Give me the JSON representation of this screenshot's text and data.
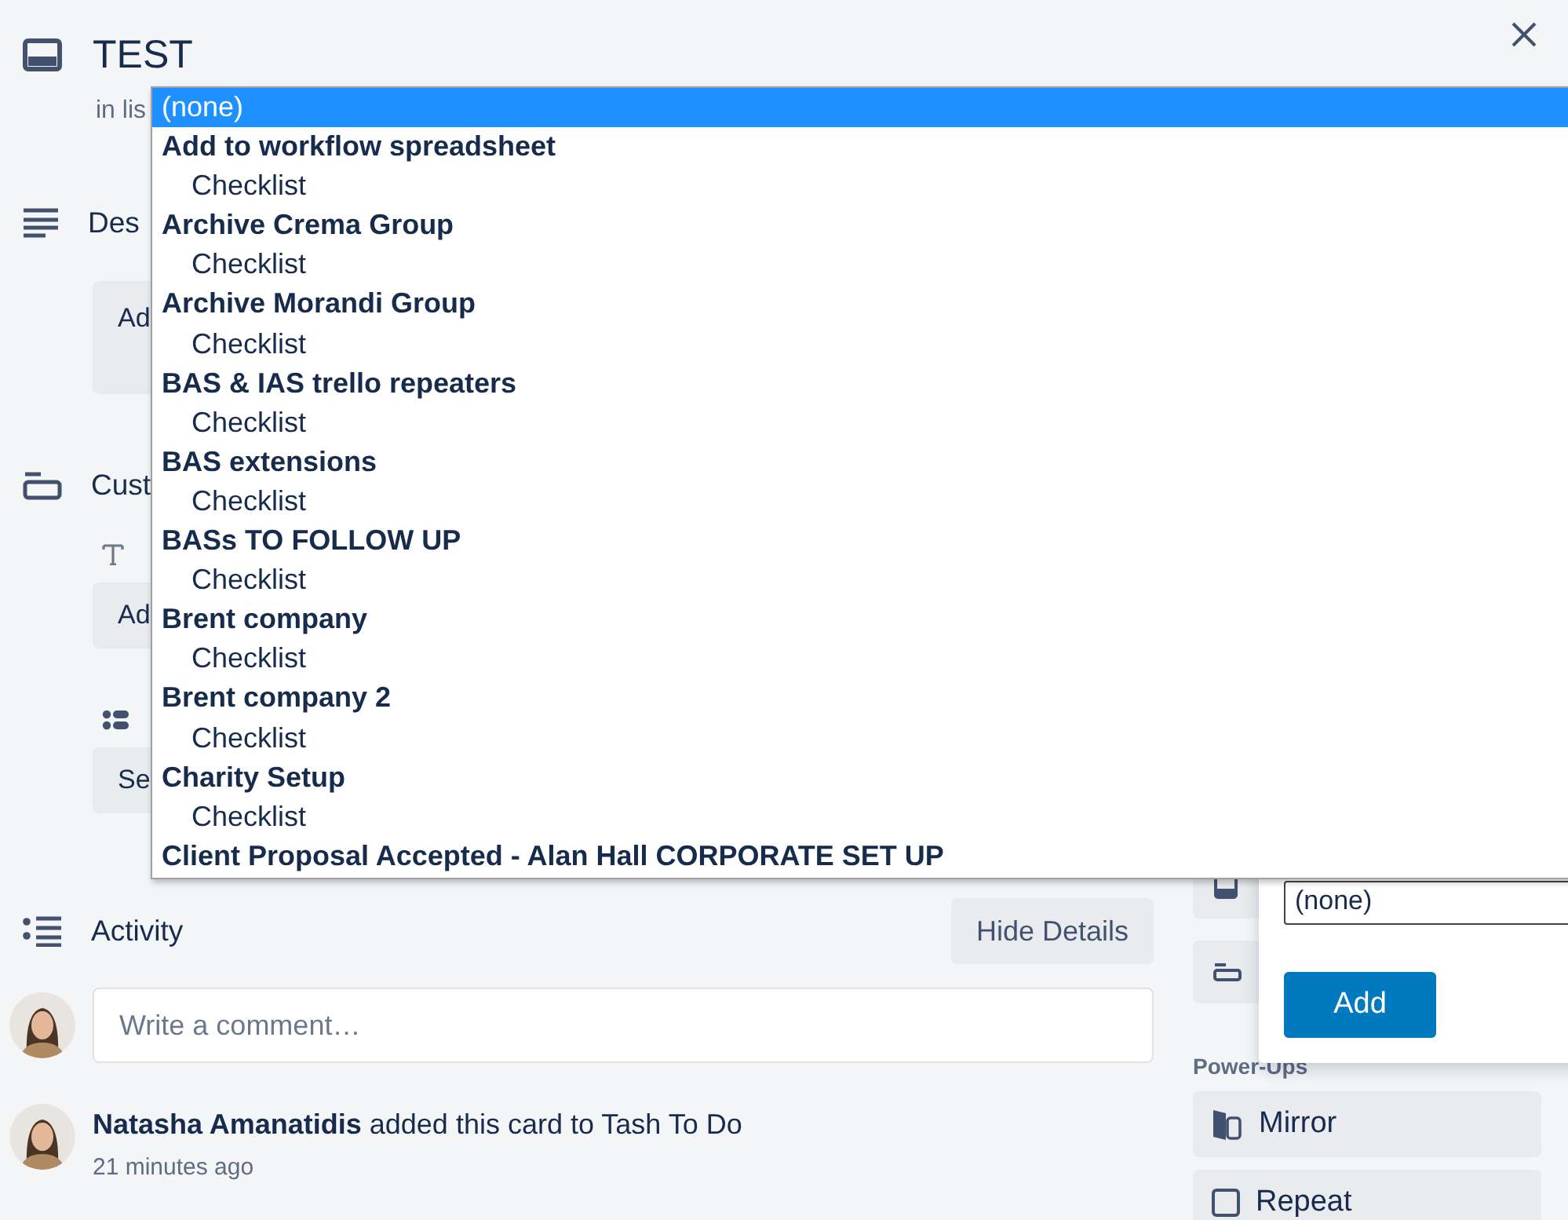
{
  "card": {
    "title": "TEST",
    "list_caption": "in lis"
  },
  "description": {
    "heading": "Des",
    "field_text": "Ad"
  },
  "custom_fields": {
    "heading": "Cust",
    "fields": [
      {
        "kind": "text",
        "value": "Ad"
      },
      {
        "kind": "list",
        "value": "Se"
      }
    ]
  },
  "activity": {
    "heading": "Activity",
    "toggle_button": "Hide Details",
    "comment_placeholder": "Write a comment…",
    "entries": [
      {
        "text": "**Natasha Amanatidis** added this card to Tash To Do",
        "time": "21 minutes ago"
      }
    ]
  },
  "dropdown": {
    "items": [
      {
        "kind": "option",
        "label": "(none)",
        "selected": true
      },
      {
        "kind": "group",
        "label": "Add to workflow spreadsheet",
        "children": [
          {
            "label": "Checklist",
            "selected": false
          }
        ]
      },
      {
        "kind": "group",
        "label": "Archive Crema Group",
        "children": [
          {
            "label": "Checklist",
            "selected": false
          }
        ]
      },
      {
        "kind": "group",
        "label": "Archive Morandi Group",
        "children": [
          {
            "label": "Checklist",
            "selected": false
          }
        ]
      },
      {
        "kind": "group",
        "label": "BAS & IAS trello repeaters",
        "children": [
          {
            "label": "Checklist",
            "selected": false
          }
        ]
      },
      {
        "kind": "group",
        "label": "BAS extensions",
        "children": [
          {
            "label": "Checklist",
            "selected": false
          }
        ]
      },
      {
        "kind": "group",
        "label": "BASs TO FOLLOW UP",
        "children": [
          {
            "label": "Checklist",
            "selected": false
          }
        ]
      },
      {
        "kind": "group",
        "label": "Brent company",
        "children": [
          {
            "label": "Checklist",
            "selected": false
          }
        ]
      },
      {
        "kind": "group",
        "label": "Brent company 2",
        "children": [
          {
            "label": "Checklist",
            "selected": false
          }
        ]
      },
      {
        "kind": "group",
        "label": "Charity Setup",
        "children": [
          {
            "label": "Checklist",
            "selected": false
          }
        ]
      },
      {
        "kind": "group",
        "label": "Client Proposal Accepted - Alan Hall CORPORATE SET UP"
      }
    ]
  },
  "sidebar": {
    "buttons": [
      {
        "kind": "card"
      },
      {
        "kind": "field"
      }
    ],
    "section_label": "Power-Ups",
    "power_ups": [
      {
        "kind": "mirror",
        "label": "Mirror"
      },
      {
        "kind": "repeat",
        "label": "Repeat"
      }
    ]
  },
  "popover": {
    "select_value": "(none)",
    "button": "Add"
  }
}
